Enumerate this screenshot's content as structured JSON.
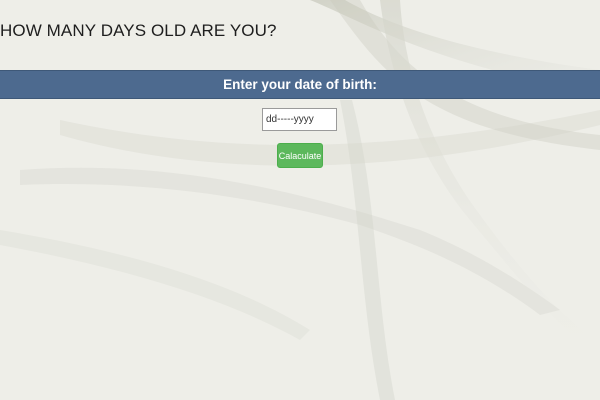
{
  "page": {
    "title": "HOW MANY DAYS OLD ARE YOU?"
  },
  "banner": {
    "label": "Enter your date of birth:"
  },
  "dob_field": {
    "value": "",
    "placeholder": "dd-----yyyy"
  },
  "calculate_button": {
    "label": "Calaculate"
  },
  "colors": {
    "background": "#ecece6",
    "banner": "#4d6a8f",
    "button": "#5cb85c"
  }
}
